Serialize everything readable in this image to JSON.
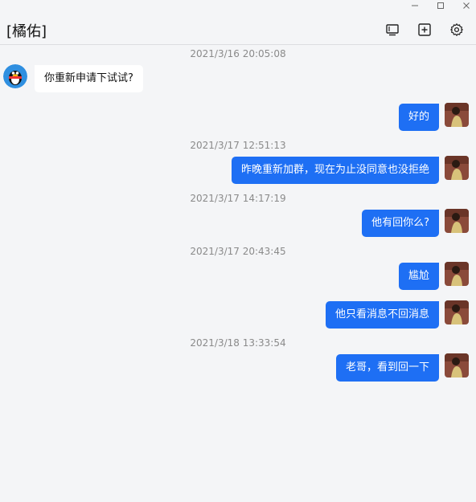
{
  "window": {
    "title": "[橘佑]",
    "controls": {
      "minimize_icon": "minimize-icon",
      "maximize_icon": "maximize-icon",
      "close_icon": "close-icon"
    }
  },
  "header_actions": [
    {
      "icon": "monitor-icon"
    },
    {
      "icon": "add-box-icon"
    },
    {
      "icon": "gear-icon"
    }
  ],
  "colors": {
    "bubble_out": "#1e6ff4",
    "bubble_in": "#ffffff",
    "background": "#f4f5f7"
  },
  "messages": [
    {
      "type": "timestamp",
      "text": "2021/3/16 20:05:08"
    },
    {
      "type": "incoming",
      "text": "你重新申请下试试?"
    },
    {
      "type": "outgoing",
      "text": "好的"
    },
    {
      "type": "timestamp",
      "text": "2021/3/17 12:51:13"
    },
    {
      "type": "outgoing",
      "text": "昨晚重新加群，现在为止没同意也没拒绝"
    },
    {
      "type": "timestamp",
      "text": "2021/3/17 14:17:19"
    },
    {
      "type": "outgoing",
      "text": "他有回你么?"
    },
    {
      "type": "timestamp",
      "text": "2021/3/17 20:43:45"
    },
    {
      "type": "outgoing",
      "text": "尴尬"
    },
    {
      "type": "outgoing",
      "text": "他只看消息不回消息"
    },
    {
      "type": "timestamp",
      "text": "2021/3/18 13:33:54"
    },
    {
      "type": "outgoing",
      "text": "老哥，看到回一下"
    }
  ]
}
